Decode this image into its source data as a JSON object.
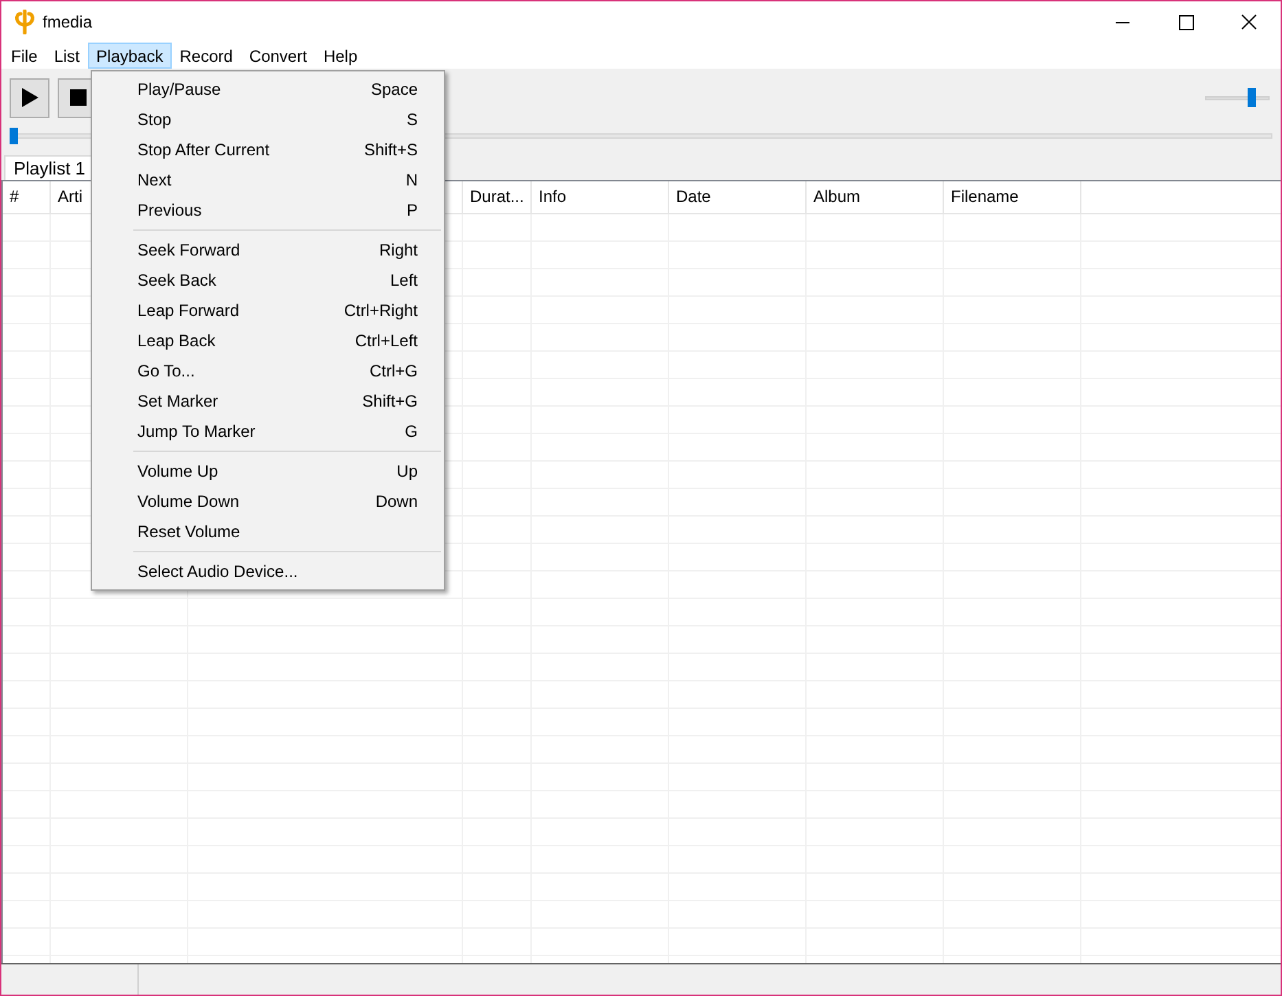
{
  "window": {
    "title": "fmedia"
  },
  "menu_bar": [
    {
      "label": "File",
      "selected": false
    },
    {
      "label": "List",
      "selected": false
    },
    {
      "label": "Playback",
      "selected": true
    },
    {
      "label": "Record",
      "selected": false
    },
    {
      "label": "Convert",
      "selected": false
    },
    {
      "label": "Help",
      "selected": false
    }
  ],
  "volume_slider": {
    "level": 0.76
  },
  "seek_slider": {
    "level": 0
  },
  "tabs": [
    {
      "label": "Playlist 1",
      "selected": true
    }
  ],
  "table": {
    "columns": [
      {
        "kind": "text",
        "label": "#"
      },
      {
        "kind": "text",
        "label": "Arti"
      },
      {
        "kind": "covered"
      },
      {
        "kind": "text",
        "label": "Durat..."
      },
      {
        "kind": "text",
        "label": "Info"
      },
      {
        "kind": "text",
        "label": "Date"
      },
      {
        "kind": "text",
        "label": "Album"
      },
      {
        "kind": "text",
        "label": "Filename"
      }
    ]
  },
  "dropdown_menu": {
    "items": [
      {
        "kind": "item",
        "label": "Play/Pause",
        "shortcut": "Space"
      },
      {
        "kind": "item",
        "label": "Stop",
        "shortcut": "S"
      },
      {
        "kind": "item",
        "label": "Stop After Current",
        "shortcut": "Shift+S"
      },
      {
        "kind": "item",
        "label": "Next",
        "shortcut": "N"
      },
      {
        "kind": "item",
        "label": "Previous",
        "shortcut": "P"
      },
      {
        "kind": "separator"
      },
      {
        "kind": "item",
        "label": "Seek Forward",
        "shortcut": "Right"
      },
      {
        "kind": "item",
        "label": "Seek Back",
        "shortcut": "Left"
      },
      {
        "kind": "item",
        "label": "Leap Forward",
        "shortcut": "Ctrl+Right"
      },
      {
        "kind": "item",
        "label": "Leap Back",
        "shortcut": "Ctrl+Left"
      },
      {
        "kind": "item",
        "label": "Go To...",
        "shortcut": "Ctrl+G"
      },
      {
        "kind": "item",
        "label": "Set Marker",
        "shortcut": "Shift+G"
      },
      {
        "kind": "item",
        "label": "Jump To Marker",
        "shortcut": "G"
      },
      {
        "kind": "separator"
      },
      {
        "kind": "item",
        "label": "Volume Up",
        "shortcut": "Up"
      },
      {
        "kind": "item",
        "label": "Volume Down",
        "shortcut": "Down"
      },
      {
        "kind": "item",
        "label": "Reset Volume"
      },
      {
        "kind": "separator"
      },
      {
        "kind": "item",
        "label": "Select Audio Device..."
      }
    ]
  }
}
